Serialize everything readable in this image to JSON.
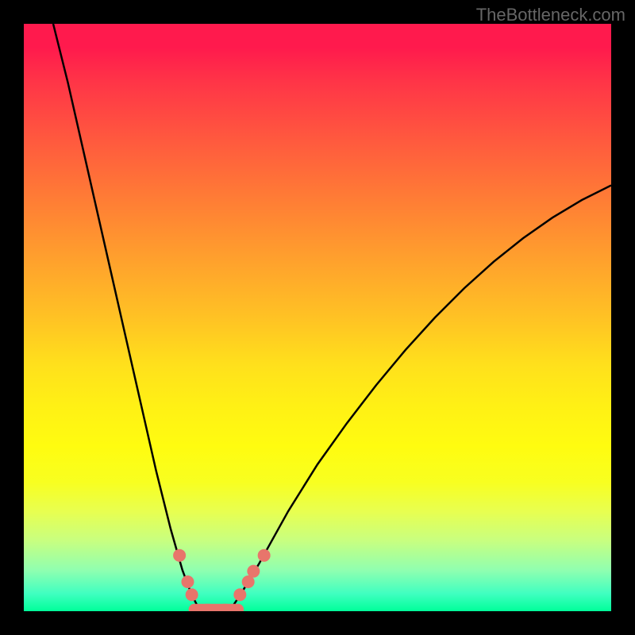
{
  "watermark": "TheBottleneck.com",
  "chart_data": {
    "type": "line",
    "title": "",
    "xlabel": "",
    "ylabel": "",
    "xlim": [
      0,
      100
    ],
    "ylim": [
      0,
      100
    ],
    "series": [
      {
        "name": "left-curve",
        "x": [
          5,
          7.5,
          10,
          12.5,
          15,
          17.5,
          20,
          22.5,
          25,
          27,
          28.5,
          30
        ],
        "values": [
          100,
          90,
          79,
          68,
          57,
          46,
          35,
          24,
          14,
          7,
          3,
          0
        ]
      },
      {
        "name": "right-curve",
        "x": [
          35,
          37,
          40,
          45,
          50,
          55,
          60,
          65,
          70,
          75,
          80,
          85,
          90,
          95,
          100
        ],
        "values": [
          0,
          3,
          8,
          17,
          25,
          32,
          38.5,
          44.5,
          50,
          55,
          59.5,
          63.5,
          67,
          70,
          72.5
        ]
      },
      {
        "name": "bottom-flat",
        "x": [
          30,
          35
        ],
        "values": [
          0,
          0
        ]
      }
    ],
    "markers": [
      {
        "x": 26.5,
        "y": 9.5
      },
      {
        "x": 27.9,
        "y": 5
      },
      {
        "x": 28.6,
        "y": 2.8
      },
      {
        "x": 36.8,
        "y": 2.8
      },
      {
        "x": 38.2,
        "y": 5
      },
      {
        "x": 39.1,
        "y": 6.8
      },
      {
        "x": 40.9,
        "y": 9.5
      }
    ],
    "bottom_segments": [
      {
        "x1": 29,
        "x2": 31.5
      },
      {
        "x1": 31,
        "x2": 34.5
      },
      {
        "x1": 34,
        "x2": 36.5
      }
    ],
    "gradient_stops": [
      {
        "pos": 0.0,
        "color": "#ff1a4d"
      },
      {
        "pos": 0.5,
        "color": "#ffc224"
      },
      {
        "pos": 0.78,
        "color": "#f8ff20"
      },
      {
        "pos": 1.0,
        "color": "#00ff9a"
      }
    ]
  }
}
